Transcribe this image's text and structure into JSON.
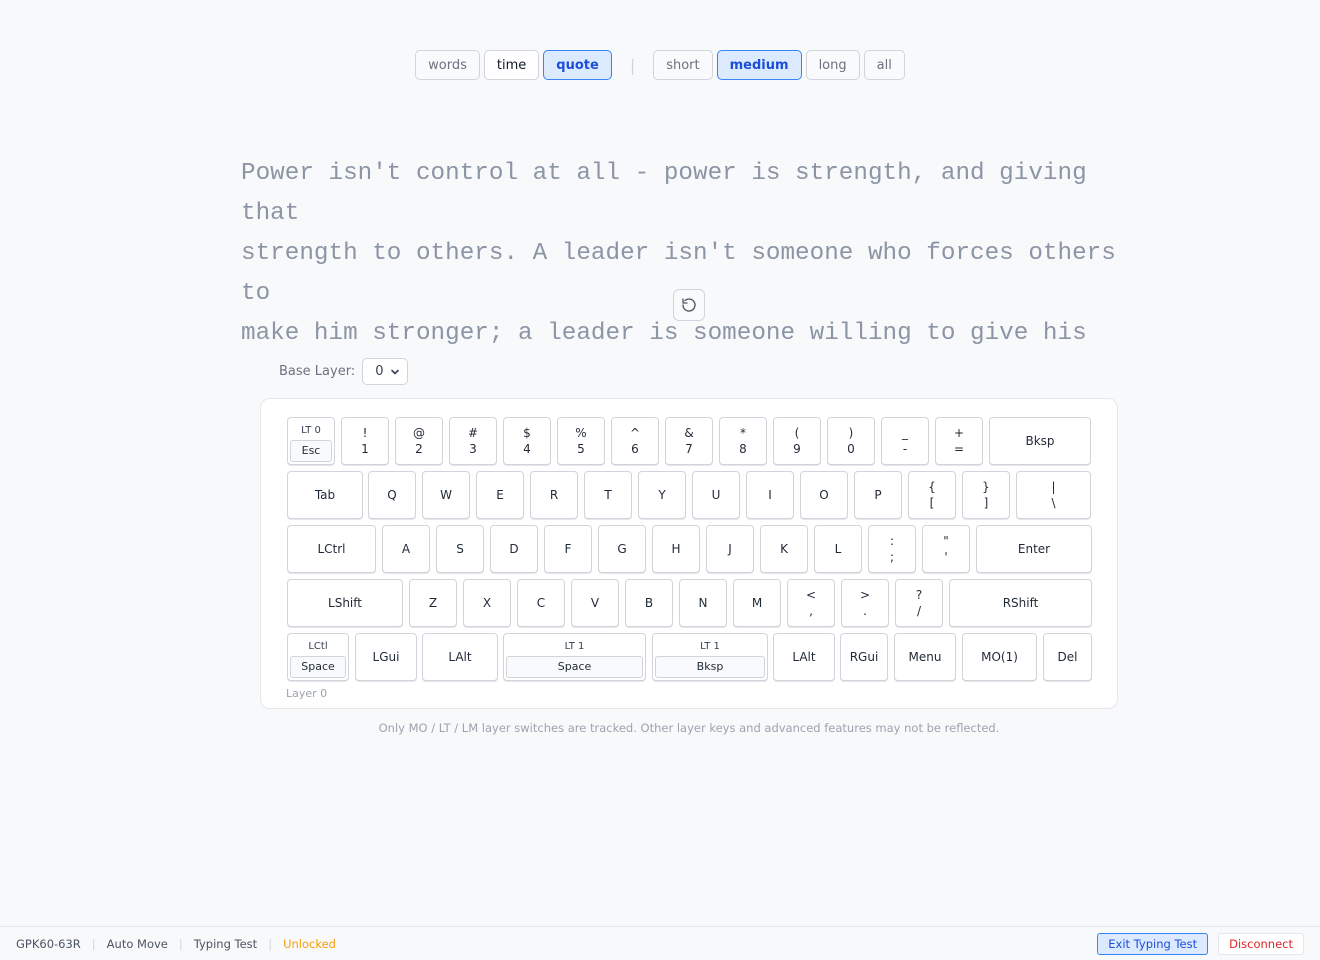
{
  "modes": {
    "types": [
      {
        "label": "words",
        "active": false
      },
      {
        "label": "time",
        "active": false
      },
      {
        "label": "quote",
        "active": true
      }
    ],
    "lengths": [
      {
        "label": "short",
        "active": false
      },
      {
        "label": "medium",
        "active": true
      },
      {
        "label": "long",
        "active": false
      },
      {
        "label": "all",
        "active": false
      }
    ],
    "separator": "|"
  },
  "quote": {
    "lines": [
      "Power isn't control at all - power is strength, and giving that",
      "strength to others. A leader isn't someone who forces others to",
      "make him stronger; a leader is someone willing to give his"
    ]
  },
  "reset_icon": "rotate-ccw-icon",
  "base_layer": {
    "label": "Base Layer:",
    "value": "0",
    "icon": "chevron-down-icon"
  },
  "keyboard": {
    "layer_label": "Layer 0",
    "rows": [
      [
        {
          "split": true,
          "small": "LT 0",
          "label": "Esc"
        },
        {
          "top": "!",
          "label": "1"
        },
        {
          "top": "@",
          "label": "2"
        },
        {
          "top": "#",
          "label": "3"
        },
        {
          "top": "$",
          "label": "4"
        },
        {
          "top": "%",
          "label": "5"
        },
        {
          "top": "^",
          "label": "6"
        },
        {
          "top": "&",
          "label": "7"
        },
        {
          "top": "*",
          "label": "8"
        },
        {
          "top": "(",
          "label": "9"
        },
        {
          "top": ")",
          "label": "0"
        },
        {
          "top": "_",
          "label": "-"
        },
        {
          "top": "+",
          "label": "="
        },
        {
          "label": "Bksp"
        }
      ],
      [
        {
          "label": "Tab"
        },
        {
          "label": "Q"
        },
        {
          "label": "W"
        },
        {
          "label": "E"
        },
        {
          "label": "R"
        },
        {
          "label": "T"
        },
        {
          "label": "Y"
        },
        {
          "label": "U"
        },
        {
          "label": "I"
        },
        {
          "label": "O"
        },
        {
          "label": "P"
        },
        {
          "top": "{",
          "label": "["
        },
        {
          "top": "}",
          "label": "]"
        },
        {
          "top": "|",
          "label": "\\"
        }
      ],
      [
        {
          "label": "LCtrl"
        },
        {
          "label": "A"
        },
        {
          "label": "S"
        },
        {
          "label": "D"
        },
        {
          "label": "F"
        },
        {
          "label": "G"
        },
        {
          "label": "H"
        },
        {
          "label": "J"
        },
        {
          "label": "K"
        },
        {
          "label": "L"
        },
        {
          "top": ":",
          "label": ";"
        },
        {
          "top": "\"",
          "label": "'"
        },
        {
          "label": "Enter"
        }
      ],
      [
        {
          "label": "LShift"
        },
        {
          "label": "Z"
        },
        {
          "label": "X"
        },
        {
          "label": "C"
        },
        {
          "label": "V"
        },
        {
          "label": "B"
        },
        {
          "label": "N"
        },
        {
          "label": "M"
        },
        {
          "top": "<",
          "label": ","
        },
        {
          "top": ">",
          "label": "."
        },
        {
          "top": "?",
          "label": "/"
        },
        {
          "label": "RShift"
        }
      ],
      [
        {
          "split": true,
          "small": "LCtl",
          "label": "Space"
        },
        {
          "label": "LGui"
        },
        {
          "label": "LAlt"
        },
        {
          "split": true,
          "small": "LT 1",
          "label": "Space"
        },
        {
          "split": true,
          "small": "LT 1",
          "label": "Bksp"
        },
        {
          "label": "LAlt"
        },
        {
          "label": "RGui"
        },
        {
          "label": "Menu"
        },
        {
          "label": "MO(1)"
        },
        {
          "label": "Del"
        }
      ]
    ]
  },
  "note": "Only MO / LT / LM layer switches are tracked. Other layer keys and advanced features may not be reflected.",
  "status": {
    "items": [
      "GPK60-63R",
      "Auto Move",
      "Typing Test"
    ],
    "unlocked": "Unlocked",
    "exit_button": "Exit Typing Test",
    "disconnect_button": "Disconnect"
  }
}
